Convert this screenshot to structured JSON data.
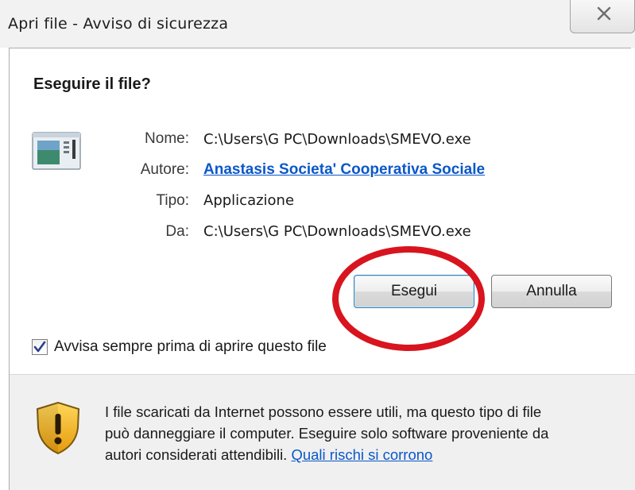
{
  "window": {
    "title": "Apri file - Avviso di sicurezza",
    "close_glyph": "☒"
  },
  "dialog": {
    "heading": "Eseguire il file?",
    "icon": "application-window-icon",
    "fields": [
      {
        "label": "Nome:",
        "value": "C:\\Users\\G PC\\Downloads\\SMEVO.exe"
      },
      {
        "label": "Autore:",
        "value": "Anastasis Societa' Cooperativa Sociale",
        "is_link": true
      },
      {
        "label": "Tipo:",
        "value": "Applicazione"
      },
      {
        "label": "Da:",
        "value": "C:\\Users\\G PC\\Downloads\\SMEVO.exe"
      }
    ],
    "buttons": {
      "run_label": "Esegui",
      "cancel_label": "Annulla"
    },
    "checkbox": {
      "label": "Avvisa sempre prima di aprire questo file",
      "checked": true
    }
  },
  "footer": {
    "icon": "warning-shield-icon",
    "lines": [
      "I file scaricati da Internet possono essere utili, ma questo tipo di file",
      "può danneggiare il computer. Eseguire solo software proveniente da",
      "autori considerati attendibili."
    ],
    "link_text": "Quali rischi si corrono"
  },
  "annotation": {
    "highlight_color": "#d8141e",
    "highlight_target": "run-button"
  },
  "colors": {
    "link": "#0b57c9",
    "footer_bg": "#f0f0f0",
    "shield": "#f2b418"
  }
}
